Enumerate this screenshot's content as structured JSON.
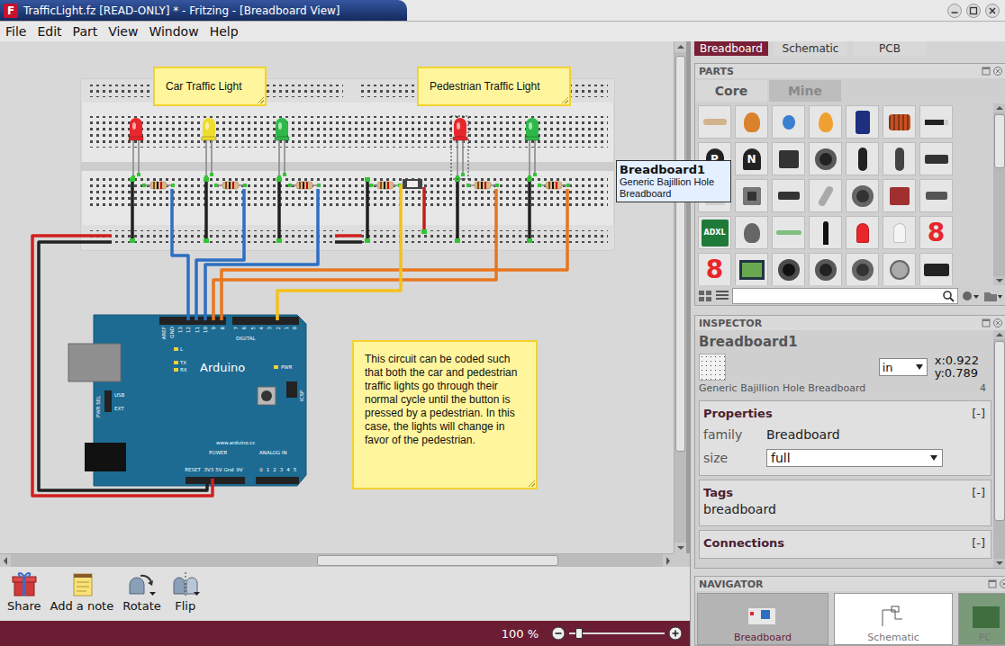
{
  "window": {
    "title": "TrafficLight.fz [READ-ONLY] * - Fritzing - [Breadboard View]",
    "app_icon": "F"
  },
  "menu": [
    "File",
    "Edit",
    "Part",
    "View",
    "Window",
    "Help"
  ],
  "canvas": {
    "notes": [
      {
        "text": "Car Traffic Light"
      },
      {
        "text": "Pedestrian Traffic Light"
      },
      {
        "text": "This circuit can be coded such that both the car and pedestrian traffic lights go through their normal cycle until the button is pressed by a pedestrian. In this case, the lights will change in favor of the pedestrian."
      }
    ],
    "leds": [
      {
        "color": "#e8262b",
        "selected": false
      },
      {
        "color": "#f0dc2a",
        "selected": false
      },
      {
        "color": "#2fb84a",
        "selected": false
      },
      {
        "color": "#e8262b",
        "selected": true
      },
      {
        "color": "#2fb84a",
        "selected": false
      }
    ],
    "wires": [
      {
        "color": "#2d6fc2"
      },
      {
        "color": "#2d6fc2"
      },
      {
        "color": "#2d6fc2"
      },
      {
        "color": "#e8761f"
      },
      {
        "color": "#e8761f"
      },
      {
        "color": "#f2c21b"
      },
      {
        "color": "#d11f1f"
      },
      {
        "color": "#202020"
      },
      {
        "color": "#d11f1f"
      },
      {
        "color": "#202020"
      }
    ],
    "arduino": {
      "name": "Arduino",
      "site": "www.arduino.cc",
      "digital": "DIGITAL",
      "pins_top": [
        "AREF",
        "GND",
        "13",
        "12",
        "11",
        "10",
        "9",
        "8",
        "7",
        "6",
        "5",
        "4",
        "3",
        "2",
        "1",
        "0"
      ],
      "power": "POWER",
      "analog": "ANALOG IN",
      "power_pins": [
        "RESET",
        "3V3",
        "5V",
        "Gnd",
        "9V"
      ],
      "analog_pins": [
        "0",
        "1",
        "2",
        "3",
        "4",
        "5"
      ],
      "icsp": "ICSP",
      "pwr": "PWR",
      "pwr_sel": "PWR SEL",
      "usb": "USB",
      "ext": "EXT",
      "leds": [
        "L",
        "TX",
        "RX"
      ]
    },
    "tooltip": {
      "title": "Breadboard1",
      "text": "Generic Bajillion Hole Breadboard"
    }
  },
  "toolbar": [
    {
      "label": "Share",
      "kind": "gift",
      "menu": false
    },
    {
      "label": "Add a note",
      "kind": "note",
      "menu": false
    },
    {
      "label": "Rotate",
      "kind": "rotate",
      "menu": true
    },
    {
      "label": "Flip",
      "kind": "flip",
      "menu": true
    }
  ],
  "status": {
    "zoom": "100 %",
    "level": 0.1
  },
  "dock": {
    "view_tabs": [
      {
        "label": "Breadboard",
        "selected": true
      },
      {
        "label": "Schematic",
        "selected": false
      },
      {
        "label": "PCB",
        "selected": false
      }
    ],
    "parts": {
      "title": "PARTS",
      "tabs": [
        {
          "label": "Core",
          "selected": true
        },
        {
          "label": "Mine",
          "selected": false
        }
      ],
      "items": [
        {
          "kind": "resistor",
          "color": "#d2b48c"
        },
        {
          "kind": "blob",
          "color": "#d9822b"
        },
        {
          "kind": "cap",
          "color": "#3a7fd0"
        },
        {
          "kind": "drop",
          "color": "#f0a030"
        },
        {
          "kind": "cylinder",
          "color": "#1f2f80"
        },
        {
          "kind": "coil",
          "color": "#c8501e"
        },
        {
          "kind": "diode",
          "color": "#222222"
        },
        {
          "kind": "transistor",
          "color": "#222222",
          "label": "P"
        },
        {
          "kind": "transistor",
          "color": "#222222",
          "label": "N"
        },
        {
          "kind": "chip",
          "color": "#333333"
        },
        {
          "kind": "disc",
          "color": "#222222"
        },
        {
          "kind": "pot",
          "color": "#222222"
        },
        {
          "kind": "pot",
          "color": "#444444"
        },
        {
          "kind": "slide",
          "color": "#333333"
        },
        {
          "kind": "chip",
          "color": "#d0d0d0"
        },
        {
          "kind": "button",
          "color": "#333333"
        },
        {
          "kind": "switch",
          "color": "#333333"
        },
        {
          "kind": "tilt",
          "color": "#aaaaaa"
        },
        {
          "kind": "disc",
          "color": "#333333"
        },
        {
          "kind": "chip",
          "color": "#a03030"
        },
        {
          "kind": "switch",
          "color": "#555555"
        },
        {
          "kind": "board",
          "color": "#1f7a3a",
          "label": "ADXL"
        },
        {
          "kind": "blob",
          "color": "#666666"
        },
        {
          "kind": "crystal",
          "color": "#7fbf7f"
        },
        {
          "kind": "joystick",
          "color": "#111111"
        },
        {
          "kind": "led",
          "color": "#e8262b"
        },
        {
          "kind": "led",
          "color": "#f4f4f4"
        },
        {
          "kind": "digit",
          "color": "#e8262b",
          "label": "8"
        },
        {
          "kind": "digit",
          "color": "#e8262b",
          "label": "8"
        },
        {
          "kind": "lcd",
          "color": "#6aa84f"
        },
        {
          "kind": "disc",
          "color": "#111111"
        },
        {
          "kind": "disc",
          "color": "#222222"
        },
        {
          "kind": "disc",
          "color": "#333333"
        },
        {
          "kind": "motor",
          "color": "#aaaaaa"
        },
        {
          "kind": "servo",
          "color": "#222222"
        }
      ]
    },
    "inspector": {
      "title": "INSPECTOR",
      "name": "Breadboard1",
      "unit": "in",
      "x": "x:0.922",
      "y": "y:0.789",
      "description": "Generic Bajillion Hole Breadboard",
      "count": "4",
      "sections": [
        {
          "title": "Properties",
          "toggle": "[-]",
          "rows": [
            {
              "label": "family",
              "value": "Breadboard",
              "kind": "text"
            },
            {
              "label": "size",
              "value": "full",
              "kind": "select"
            }
          ]
        },
        {
          "title": "Tags",
          "toggle": "[-]",
          "tags": [
            "breadboard"
          ]
        },
        {
          "title": "Connections",
          "toggle": "[-]"
        }
      ]
    },
    "navigator": {
      "title": "NAVIGATOR",
      "views": [
        {
          "label": "Breadboard",
          "selected": true,
          "kind": "breadboard"
        },
        {
          "label": "Schematic",
          "selected": false,
          "kind": "schematic"
        },
        {
          "label": "PC",
          "selected": false,
          "kind": "pcb"
        }
      ]
    }
  }
}
